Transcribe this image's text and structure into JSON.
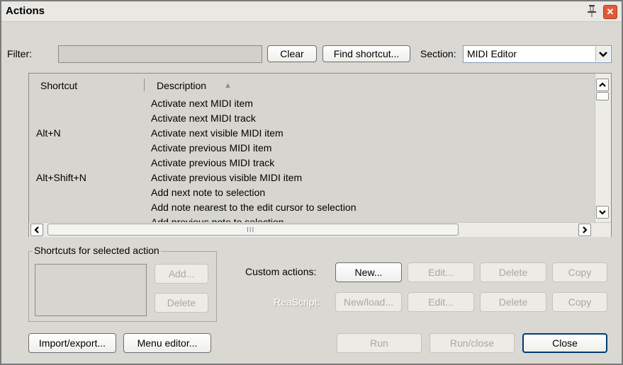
{
  "window": {
    "title": "Actions"
  },
  "filter": {
    "label": "Filter:",
    "value": "",
    "clear_label": "Clear",
    "find_shortcut_label": "Find shortcut..."
  },
  "section": {
    "label": "Section:",
    "selected": "MIDI Editor"
  },
  "list": {
    "col_shortcut": "Shortcut",
    "col_description": "Description",
    "sort_indicator": "▲",
    "rows": [
      {
        "shortcut": "",
        "description": "Activate next MIDI item"
      },
      {
        "shortcut": "",
        "description": "Activate next MIDI track"
      },
      {
        "shortcut": "Alt+N",
        "description": "Activate next visible MIDI item"
      },
      {
        "shortcut": "",
        "description": "Activate previous MIDI item"
      },
      {
        "shortcut": "",
        "description": "Activate previous MIDI track"
      },
      {
        "shortcut": "Alt+Shift+N",
        "description": "Activate previous visible MIDI item"
      },
      {
        "shortcut": "",
        "description": "Add next note to selection"
      },
      {
        "shortcut": "",
        "description": "Add note nearest to the edit cursor to selection"
      },
      {
        "shortcut": "",
        "description": "Add previous note to selection"
      }
    ],
    "hscroll_grip": "III"
  },
  "shortcuts_group": {
    "title": "Shortcuts for selected action",
    "add_label": "Add...",
    "delete_label": "Delete"
  },
  "custom_actions": {
    "label": "Custom actions:",
    "new_label": "New...",
    "edit_label": "Edit...",
    "delete_label": "Delete",
    "copy_label": "Copy"
  },
  "reascript": {
    "label": "ReaScript:",
    "new_load_label": "New/load...",
    "edit_label": "Edit...",
    "delete_label": "Delete",
    "copy_label": "Copy"
  },
  "footer": {
    "import_export_label": "Import/export...",
    "menu_editor_label": "Menu editor...",
    "run_label": "Run",
    "run_close_label": "Run/close",
    "close_label": "Close"
  }
}
